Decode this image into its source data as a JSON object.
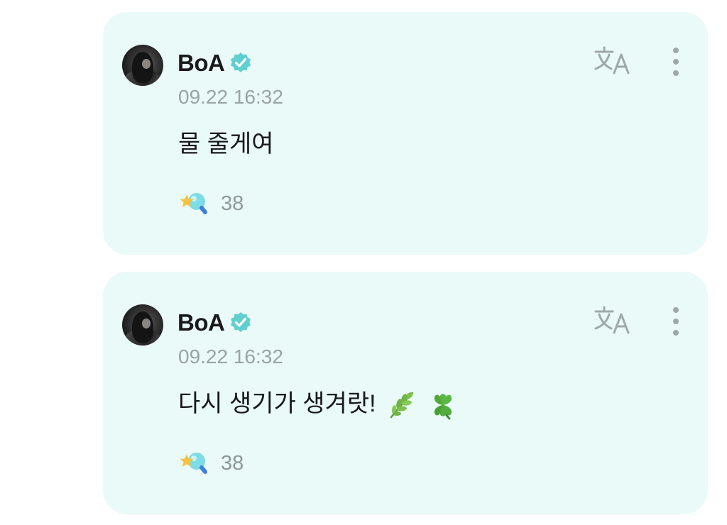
{
  "posts": [
    {
      "author": "BoA",
      "verified": true,
      "timestamp": "09.22 16:32",
      "message": "물 줄게여",
      "message_emojis": [],
      "reaction_icon": "star-bulb-icon",
      "reaction_count": "38"
    },
    {
      "author": "BoA",
      "verified": true,
      "timestamp": "09.22 16:32",
      "message": "다시 생기가 생겨랏!",
      "message_emojis": [
        "herb-emoji",
        "four-leaf-clover-emoji"
      ],
      "reaction_icon": "star-bulb-icon",
      "reaction_count": "38"
    }
  ],
  "icons": {
    "translate": "translate-icon",
    "more": "more-vertical-icon",
    "verified": "verified-badge-icon"
  },
  "colors": {
    "card_background": "#e9faf8",
    "verified_badge": "#5fcfd0",
    "muted_text": "#9aa3a3",
    "icon_gray": "#9ea8a8"
  }
}
